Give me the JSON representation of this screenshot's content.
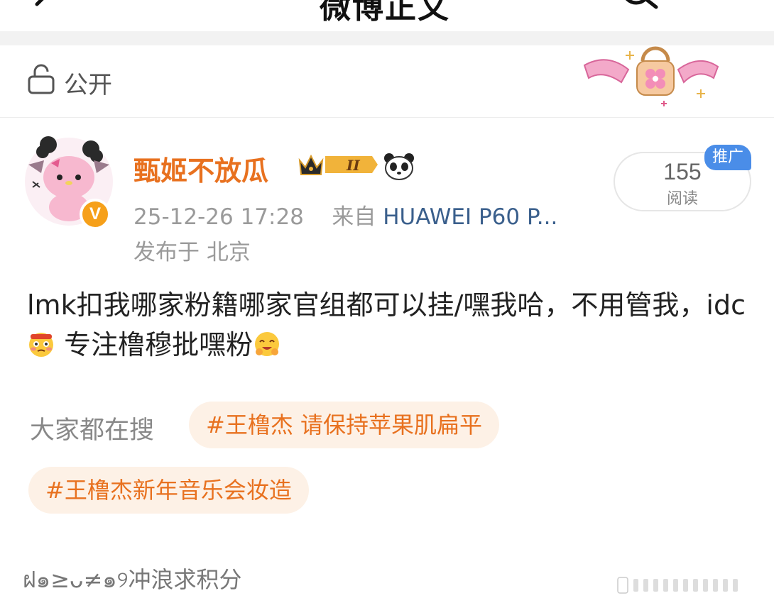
{
  "header": {
    "title": "微博正文",
    "more": "···"
  },
  "privacy": {
    "label": "公开"
  },
  "author": {
    "name": "甄姬不放瓜",
    "verified_badge": "V",
    "crown_level": "II",
    "timestamp": "25-12-26 17:28",
    "source_prefix": "来自",
    "device": "HUAWEI P60 P...",
    "location": "发布于 北京"
  },
  "stats": {
    "read_count": "155",
    "read_label": "阅读",
    "promo_label": "推广"
  },
  "post": {
    "text_part1": "lmk扣我哪家粉籍哪家官组都可以挂/嘿我哈，不用管我，idc",
    "text_part2": " 专注橹穆批嘿粉"
  },
  "trending": {
    "label": "大家都在搜",
    "tags": [
      "#王橹杰 请保持苹果肌扁平",
      "#王橹杰新年音乐会妆造"
    ]
  },
  "footer": {
    "text": "ฝ๑≥ᴗ≠๑୨冲浪求积分"
  },
  "colors": {
    "username": "#e8711f",
    "device_link": "#3a5f8c",
    "tag_bg": "#fdf1e6",
    "tag_text": "#e8711f",
    "promo_bg": "#4a8de8",
    "verified": "#f6a01a"
  },
  "icons": [
    "back-icon",
    "search-icon",
    "lock-icon",
    "panda-icon",
    "crown-icon",
    "flushed-emoji",
    "hugging-emoji"
  ]
}
